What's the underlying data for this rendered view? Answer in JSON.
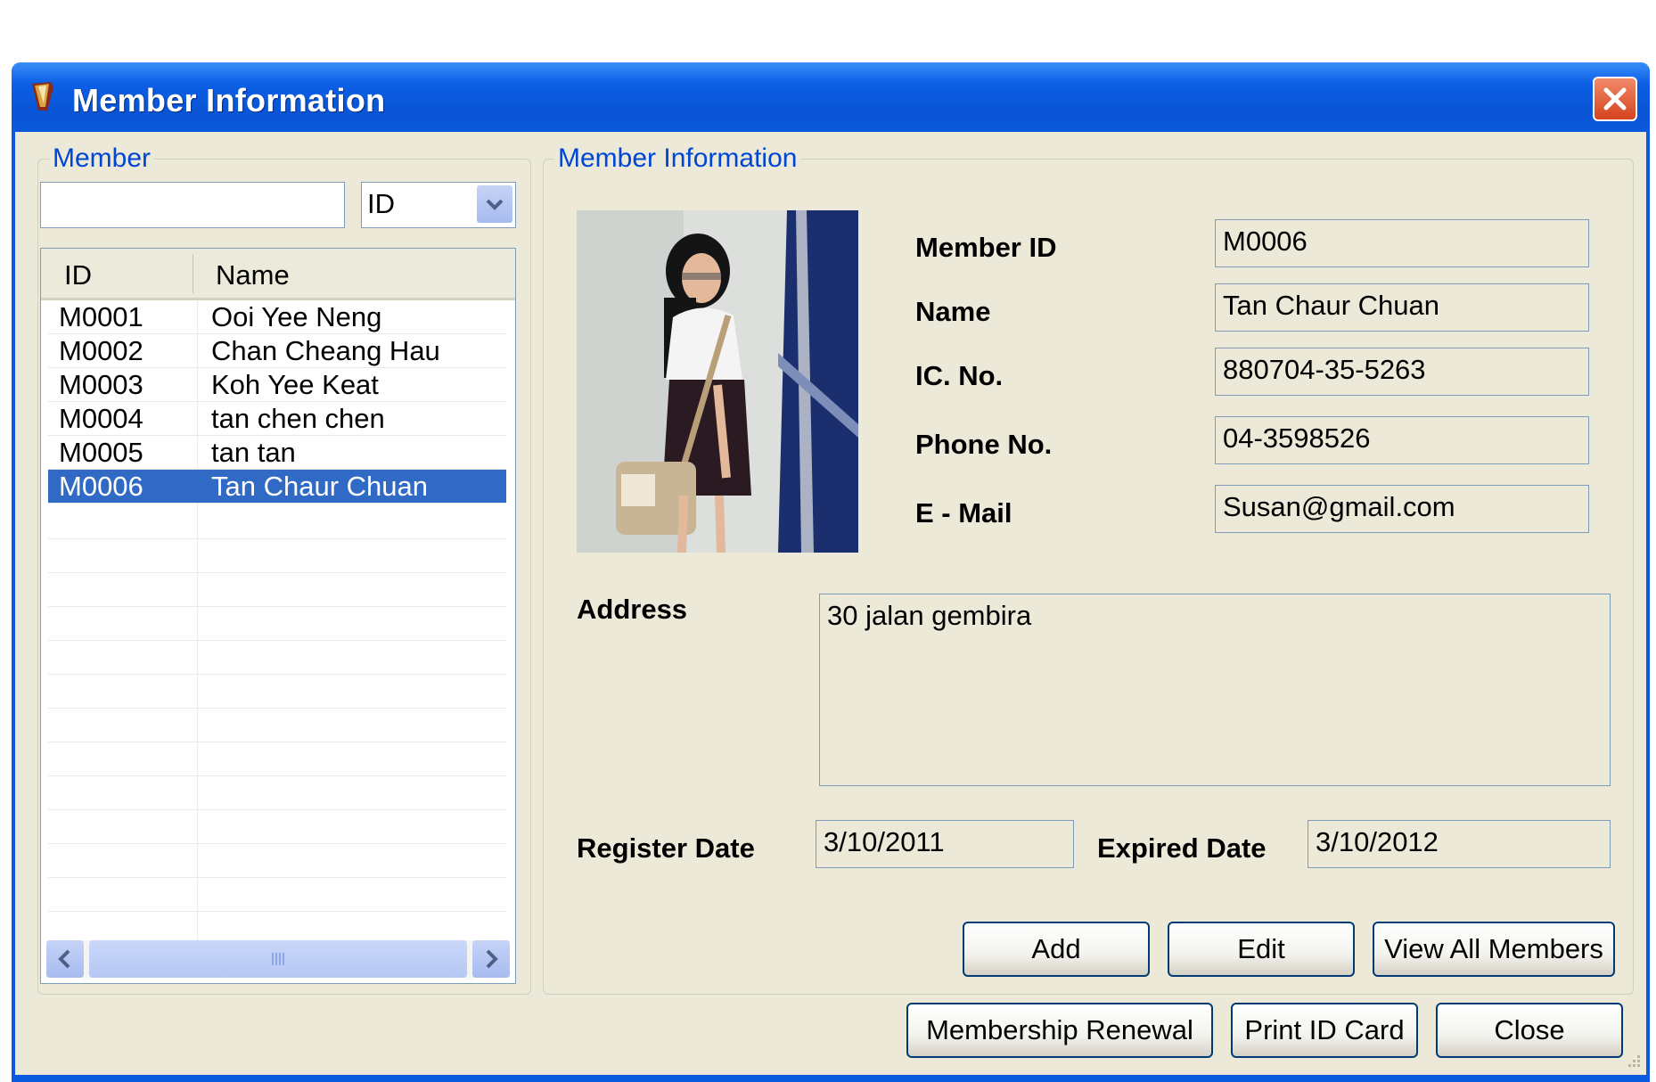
{
  "window": {
    "title": "Member Information"
  },
  "member_group": {
    "title": "Member",
    "search_value": "",
    "search_by": "ID",
    "columns": [
      "ID",
      "Name"
    ],
    "rows": [
      {
        "id": "M0001",
        "name": "Ooi Yee Neng"
      },
      {
        "id": "M0002",
        "name": "Chan Cheang Hau"
      },
      {
        "id": "M0003",
        "name": "Koh Yee Keat"
      },
      {
        "id": "M0004",
        "name": "tan chen chen"
      },
      {
        "id": "M0005",
        "name": "tan tan"
      },
      {
        "id": "M0006",
        "name": "Tan Chaur Chuan"
      }
    ],
    "selected_id": "M0006"
  },
  "info_group": {
    "title": "Member Information",
    "member_id_label": "Member ID",
    "member_id": "M0006",
    "name_label": "Name",
    "name": "Tan Chaur Chuan",
    "ic_label": "IC. No.",
    "ic": "880704-35-5263",
    "phone_label": "Phone No.",
    "phone": "04-3598526",
    "email_label": "E - Mail",
    "email": "Susan@gmail.com",
    "address_label": "Address",
    "address": "30 jalan gembira",
    "register_label": "Register Date",
    "register_date": "3/10/2011",
    "expired_label": "Expired Date",
    "expired_date": "3/10/2012"
  },
  "buttons": {
    "add": "Add",
    "edit": "Edit",
    "view_all": "View All Members",
    "renewal": "Membership Renewal",
    "print": "Print ID Card",
    "close": "Close"
  },
  "colors": {
    "accent": "#0b5be0",
    "selection": "#316ac5",
    "face": "#ece9d8"
  }
}
